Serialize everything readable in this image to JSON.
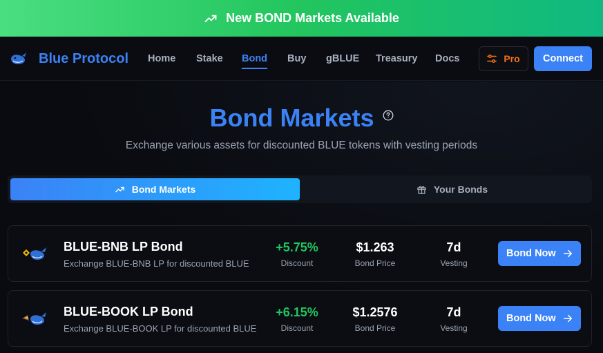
{
  "banner": {
    "text": "New BOND Markets Available",
    "icon": "trending-up-icon"
  },
  "nav": {
    "brand": "Blue Protocol",
    "links": [
      {
        "label": "Home",
        "active": false
      },
      {
        "label": "Stake",
        "active": false
      },
      {
        "label": "Bond",
        "active": true
      },
      {
        "label": "Buy",
        "active": false
      },
      {
        "label": "gBLUE",
        "active": false
      },
      {
        "label": "Treasury",
        "active": false
      },
      {
        "label": "Docs",
        "active": false
      }
    ],
    "pro_label": "Pro",
    "connect_label": "Connect"
  },
  "page": {
    "title": "Bond Markets",
    "subtitle": "Exchange various assets for discounted BLUE tokens with vesting periods"
  },
  "tabs": [
    {
      "label": "Bond Markets",
      "icon": "trending-up-icon",
      "active": true
    },
    {
      "label": "Your Bonds",
      "icon": "gift-icon",
      "active": false
    }
  ],
  "bonds": [
    {
      "name": "BLUE-BNB LP Bond",
      "description": "Exchange BLUE-BNB LP for discounted BLUE",
      "discount": "+5.75%",
      "discount_label": "Discount",
      "price": "$1.263",
      "price_label": "Bond Price",
      "vesting": "7d",
      "vesting_label": "Vesting",
      "button": "Bond Now"
    },
    {
      "name": "BLUE-BOOK LP Bond",
      "description": "Exchange BLUE-BOOK LP for discounted BLUE",
      "discount": "+6.15%",
      "discount_label": "Discount",
      "price": "$1.2576",
      "price_label": "Bond Price",
      "vesting": "7d",
      "vesting_label": "Vesting",
      "button": "Bond Now"
    }
  ],
  "colors": {
    "accent": "#3b82f6",
    "banner": "#22c55e",
    "positive": "#22c55e",
    "pro": "#f97316",
    "background": "#090b10"
  }
}
